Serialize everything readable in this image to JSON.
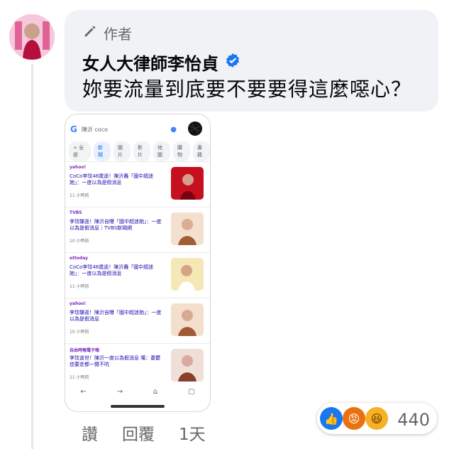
{
  "comment": {
    "badge_label": "作者",
    "author": "女人大律師李怡貞",
    "text": "妳要流量到底要不要要得這麼噁心？",
    "actions": [
      "讚",
      "回覆",
      "1天"
    ],
    "reaction_count": "440"
  },
  "phone": {
    "search_query": "陳沂 coco",
    "tabs": [
      "< 全部",
      "新聞",
      "圖片",
      "影片",
      "地圖",
      "購物",
      "書籍"
    ],
    "news": [
      {
        "source": "yahoo!",
        "title": "CoCo李玟48歲逝！陳沂轟「國中超迷她」：一度以為是假消息",
        "time": "11 小時前"
      },
      {
        "source": "TVBS",
        "title": "李玟驟逝！陳沂自曝「國中超迷她」：一度以為是假消息｜TVBS新聞網",
        "time": "10 小時前"
      },
      {
        "source": "ettoday",
        "title": "CoCo李玟48歲逝！陳沂轟「國中超迷她」：一度以為是假消息",
        "time": "11 小時前"
      },
      {
        "source": "yahoo!",
        "title": "李玟驟逝！陳沂自曝「國中超迷她」：一度以為是假消息",
        "time": "10 小時前"
      },
      {
        "source": "自由時報電子報",
        "title": "李玟逝世！陳沂一度以為假消息 嘆：憂鬱症要走都一聲不吭",
        "time": "11 小時前"
      }
    ]
  },
  "colors": {
    "bubble": "#f0f2f5",
    "like": "#1877f2",
    "angry": "#e9710f",
    "haha": "#f7b125",
    "verified": "#1877f2"
  },
  "icons": {
    "badge": "pencil-icon",
    "verified": "verified-check-icon",
    "back": "back-arrow-icon",
    "forward": "forward-arrow-icon",
    "home": "home-icon",
    "tabs": "tabs-icon"
  }
}
